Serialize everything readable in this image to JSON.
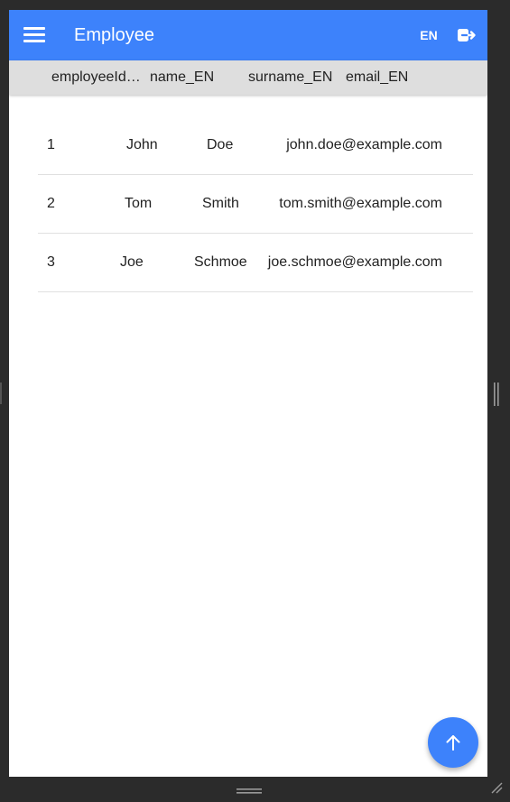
{
  "appbar": {
    "title": "Employee",
    "language": "EN",
    "menu_icon": "hamburger-menu-icon",
    "logout_icon": "logout-icon"
  },
  "table": {
    "columns": [
      "employeeId",
      "name_EN",
      "surname_EN",
      "email_EN"
    ],
    "column_display": [
      "employeeId…",
      "name_EN",
      "surname_EN",
      "email_EN"
    ],
    "rows": [
      {
        "employeeId": "1",
        "name": "John",
        "surname": "Doe",
        "email": "john.doe@example.com"
      },
      {
        "employeeId": "2",
        "name": "Tom",
        "surname": "Smith",
        "email": "tom.smith@example.com"
      },
      {
        "employeeId": "3",
        "name": "Joe",
        "surname": "Schmoe",
        "email": "joe.schmoe@example.com"
      }
    ]
  },
  "fab": {
    "icon": "arrow-up-icon"
  },
  "colors": {
    "primary": "#3d82fb",
    "header_bg": "#dedede",
    "frame_bg": "#2b2b2b"
  }
}
